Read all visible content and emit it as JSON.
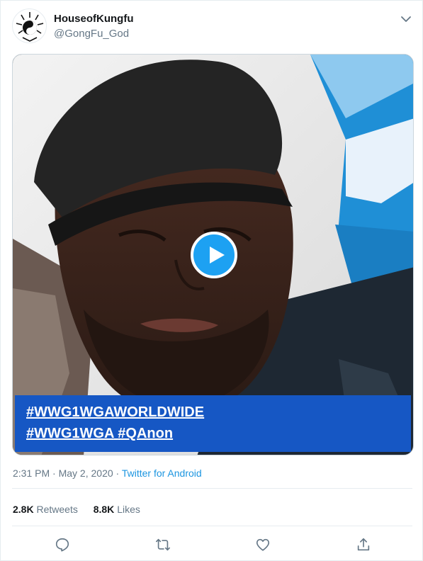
{
  "author": {
    "display_name": "HouseofKungfu",
    "handle": "@GongFu_God",
    "avatar_icon": "yin-yang-logo-icon"
  },
  "media": {
    "type": "video",
    "play_icon": "play-icon",
    "caption_lines": [
      [
        "#WWG1WGAWORLDWIDE"
      ],
      [
        "#WWG1WGA",
        "#QAnon"
      ]
    ],
    "caption_bg": "#1657c4"
  },
  "meta": {
    "time": "2:31 PM",
    "date": "May 2, 2020",
    "separator": "·",
    "source": "Twitter for Android"
  },
  "stats": {
    "retweets_count": "2.8K",
    "retweets_label": "Retweets",
    "likes_count": "8.8K",
    "likes_label": "Likes"
  },
  "actions": [
    "reply-icon",
    "retweet-icon",
    "like-icon",
    "share-icon"
  ],
  "colors": {
    "accent": "#1da1f2",
    "link": "#1b95e0",
    "secondary_text": "#657786"
  }
}
